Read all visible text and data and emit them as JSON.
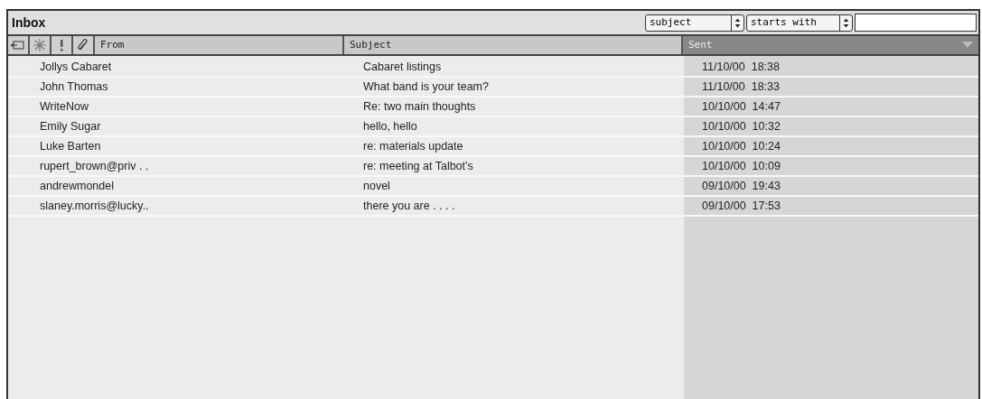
{
  "window": {
    "title": "Inbox"
  },
  "filter": {
    "field": "subject",
    "condition": "starts with"
  },
  "columns": [
    {
      "label": "From",
      "selected": false
    },
    {
      "label": "Subject",
      "selected": false
    },
    {
      "label": "Sent",
      "selected": true
    }
  ],
  "rows": [
    {
      "from": "Jollys Cabaret",
      "subject": "Cabaret listings",
      "sent": "11/10/00  18:38"
    },
    {
      "from": "John Thomas",
      "subject": "What band is your team?",
      "sent": "11/10/00  18:33"
    },
    {
      "from": "WriteNow",
      "subject": "Re: two main thoughts",
      "sent": "10/10/00  14:47"
    },
    {
      "from": "Emily Sugar",
      "subject": "hello, hello",
      "sent": "10/10/00  10:32"
    },
    {
      "from": "Luke Barten",
      "subject": "re: materials update",
      "sent": "10/10/00  10:24"
    },
    {
      "from": "rupert_brown@priv . .",
      "subject": "re: meeting at Talbot’s",
      "sent": "10/10/00  10:09"
    },
    {
      "from": "andrewmondel",
      "subject": "novel",
      "sent": "09/10/00  19:43"
    },
    {
      "from": "slaney.morris@lucky..",
      "subject": "there you are . . . .",
      "sent": "09/10/00  17:53"
    }
  ]
}
